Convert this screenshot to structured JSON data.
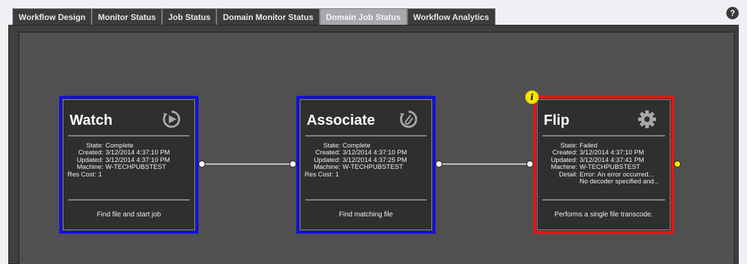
{
  "tabs": [
    {
      "label": "Workflow Design",
      "active": false
    },
    {
      "label": "Monitor Status",
      "active": false
    },
    {
      "label": "Job Status",
      "active": false
    },
    {
      "label": "Domain Monitor Status",
      "active": false
    },
    {
      "label": "Domain Job Status",
      "active": true
    },
    {
      "label": "Workflow Analytics",
      "active": false
    }
  ],
  "help": {
    "label": "?"
  },
  "colors": {
    "tab_bg": "#3c3c3c",
    "tab_active_bg": "#a7a9ac",
    "canvas_bg": "#505050",
    "node_bg": "#2f2f2f",
    "node_complete_border": "#1010e6",
    "node_failed_border": "#ea1414",
    "info_badge": "#f4e500"
  },
  "nodes": [
    {
      "title": "Watch",
      "icon": "watch-play-icon",
      "status_color": "blue",
      "labels": {
        "state": "State:",
        "created": "Created:",
        "updated": "Updated:",
        "machine": "Machine:",
        "res_cost": "Res Cost:"
      },
      "state": "Complete",
      "created": "3/12/2014 4:37:10 PM",
      "updated": "3/12/2014 4:37:10 PM",
      "machine": "W-TECHPUBSTEST",
      "res_cost": "1",
      "description": "Find file and start job"
    },
    {
      "title": "Associate",
      "icon": "associate-paperclip-icon",
      "status_color": "blue",
      "labels": {
        "state": "State:",
        "created": "Created:",
        "updated": "Updated:",
        "machine": "Machine:",
        "res_cost": "Res Cost:"
      },
      "state": "Complete",
      "created": "3/12/2014 4:37:10 PM",
      "updated": "3/12/2014 4:37:25 PM",
      "machine": "W-TECHPUBSTEST",
      "res_cost": "1",
      "description": "Find matching file"
    },
    {
      "title": "Flip",
      "icon": "gear-icon",
      "status_color": "red",
      "labels": {
        "state": "State:",
        "created": "Created:",
        "updated": "Updated:",
        "machine": "Machine:",
        "detail": "Detail:"
      },
      "state": "Failed",
      "created": "3/12/2014 4:37:10 PM",
      "updated": "3/12/2014 4:37:41 PM",
      "machine": "W-TECHPUBSTEST",
      "detail_line1": "Error: An error occurred...",
      "detail_line2": "No decoder specified and...",
      "description": "Performs a single file transcode.",
      "info_badge": "i"
    }
  ]
}
